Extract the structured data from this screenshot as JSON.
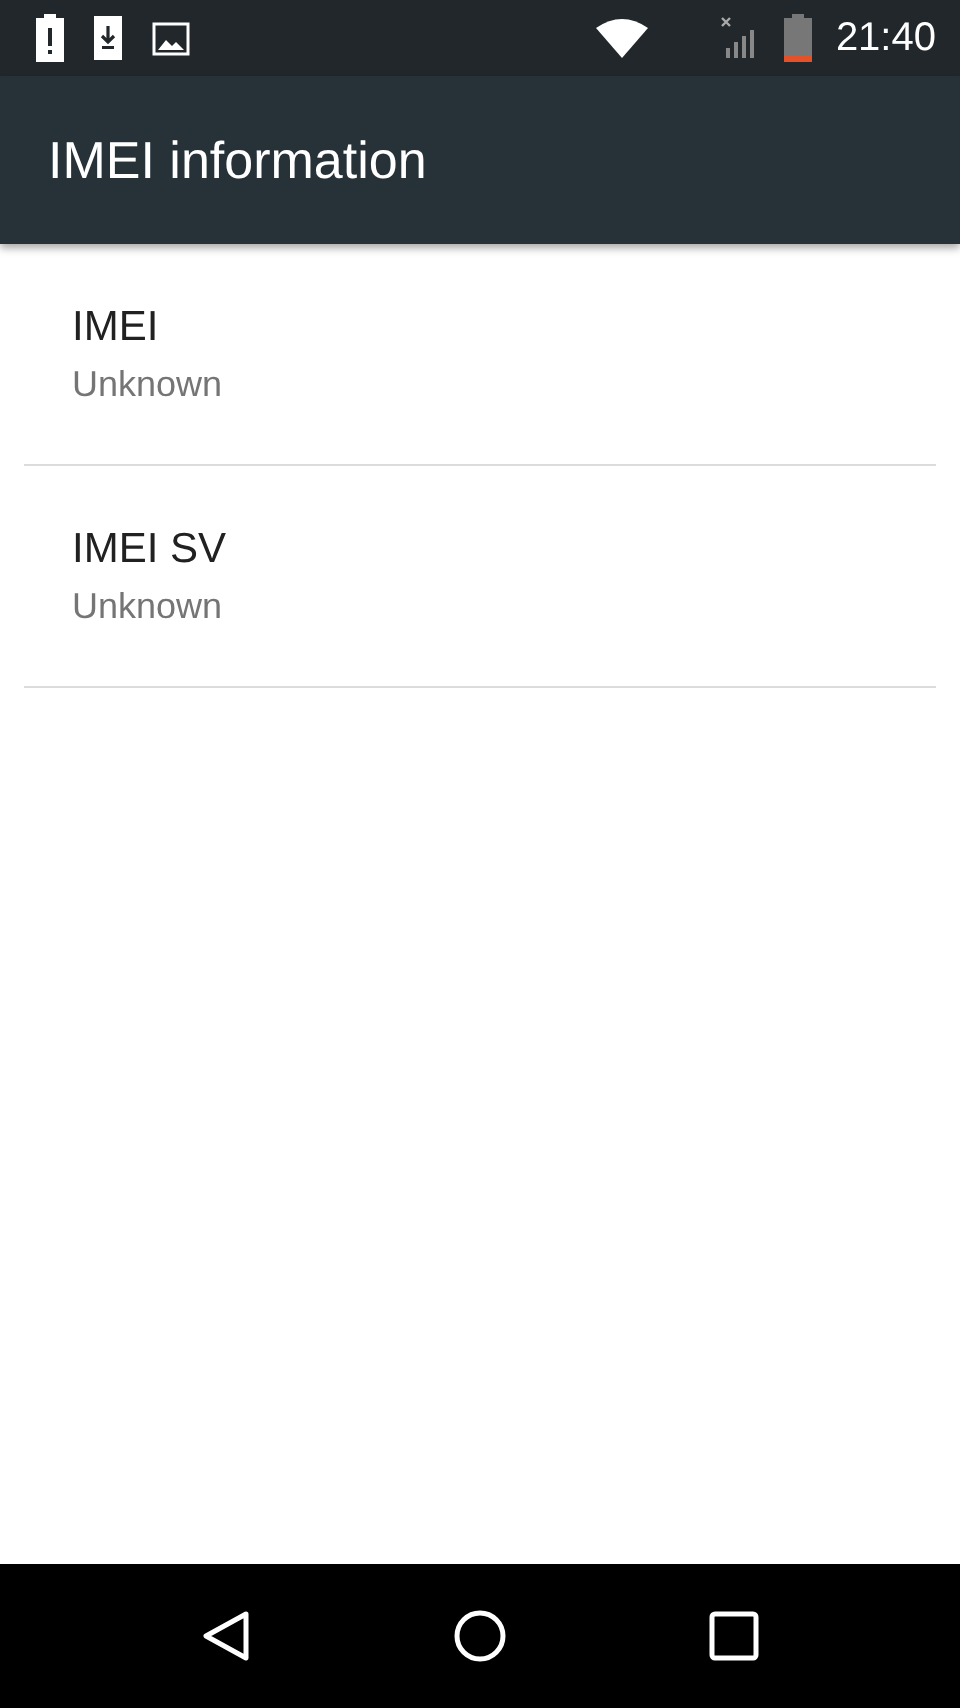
{
  "status_bar": {
    "time": "21:40"
  },
  "app_bar": {
    "title": "IMEI information"
  },
  "items": [
    {
      "title": "IMEI",
      "summary": "Unknown"
    },
    {
      "title": "IMEI SV",
      "summary": "Unknown"
    }
  ]
}
